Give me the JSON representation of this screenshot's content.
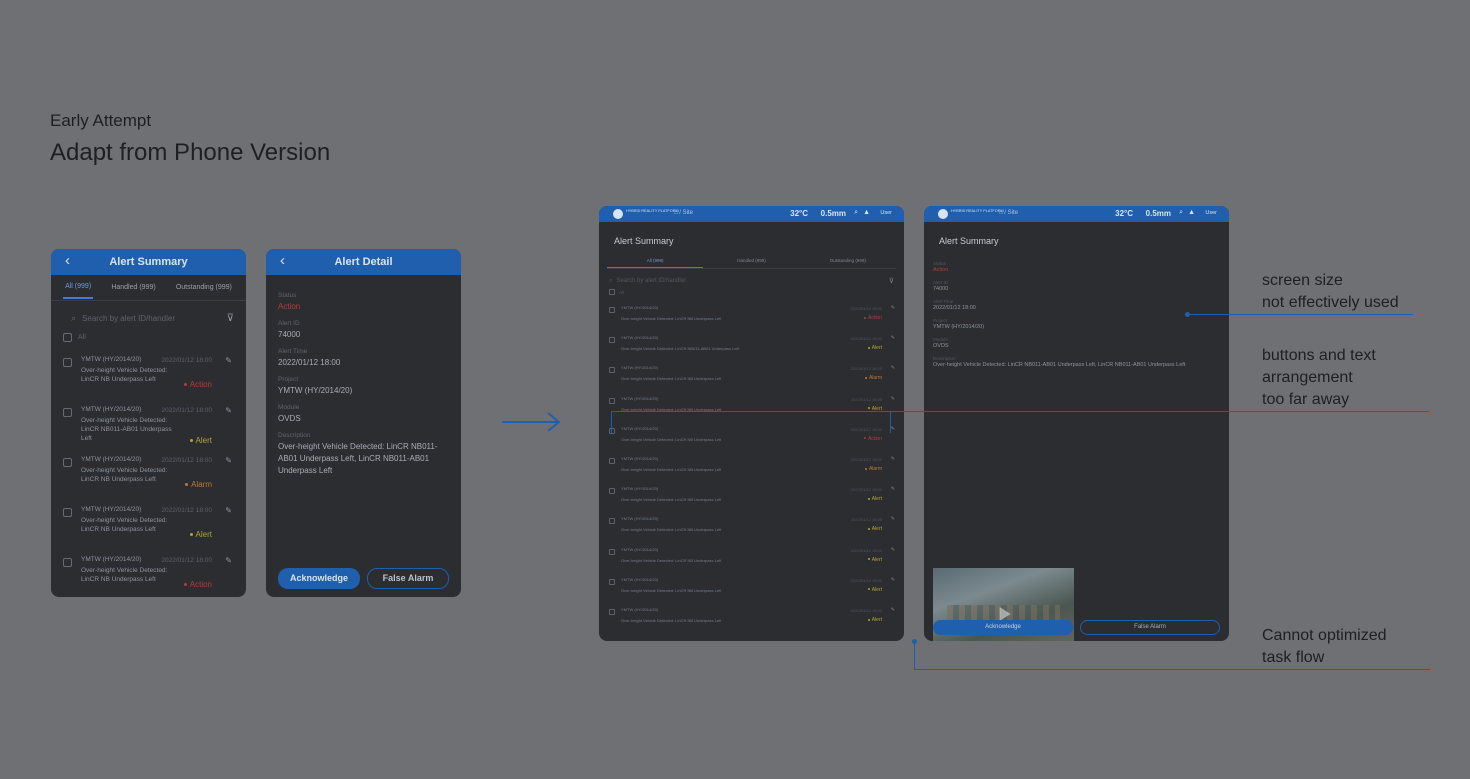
{
  "heading": {
    "sub": "Early Attempt",
    "main": "Adapt from Phone Version"
  },
  "colors": {
    "action": "#b83a3a",
    "alert": "#b5a233",
    "alarm": "#c07832",
    "accent": "#1f5fae"
  },
  "arrow_icon": "arrow-right-icon",
  "phone_summary": {
    "back": "‹",
    "title": "Alert Summary",
    "tabs": [
      "All (999)",
      "Handled (999)",
      "Outstanding (999)"
    ],
    "search_placeholder": "Search by alert ID/handler",
    "all_label": "All",
    "rows": [
      {
        "project": "YMTW (HY/2014/20)",
        "time": "2022/01/12 18:00",
        "desc": "Over-height Vehicle Detected: LinCR NB Underpass Left",
        "status": "Action"
      },
      {
        "project": "YMTW (HY/2014/20)",
        "time": "2022/01/12 18:00",
        "desc": "Over-height Vehicle Detected: LinCR NB011-AB01 Underpass Left",
        "status": "Alert"
      },
      {
        "project": "YMTW (HY/2014/20)",
        "time": "2022/01/12 18:00",
        "desc": "Over-height Vehicle Detected: LinCR NB Underpass Left",
        "status": "Alarm"
      },
      {
        "project": "YMTW (HY/2014/20)",
        "time": "2022/01/12 18:00",
        "desc": "Over-height Vehicle Detected: LinCR NB Underpass Left",
        "status": "Alert"
      },
      {
        "project": "YMTW (HY/2014/20)",
        "time": "2022/01/12 18:00",
        "desc": "Over-height Vehicle Detected: LinCR NB Underpass Left",
        "status": "Action"
      }
    ]
  },
  "phone_detail": {
    "back": "‹",
    "title": "Alert Detail",
    "fields": [
      {
        "label": "Status",
        "value": "Action"
      },
      {
        "label": "Alert ID",
        "value": "74000"
      },
      {
        "label": "Alert Time",
        "value": "2022/01/12 18:00"
      },
      {
        "label": "Project",
        "value": "YMTW (HY/2014/20)"
      },
      {
        "label": "Module",
        "value": "OVDS"
      },
      {
        "label": "Description",
        "value": "Over-height Vehicle Detected: LinCR NB011-AB01 Underpass Left, LinCR NB011-AB01 Underpass Left"
      }
    ],
    "acknowledge": "Acknowledge",
    "false_alarm": "False Alarm"
  },
  "tablet_top": {
    "brand": "HYBRID REALITY PLATFORM",
    "crumb": "⌂ / Site",
    "temp": "32°C",
    "rain": "0.5mm",
    "user": "User"
  },
  "tablet_summary": {
    "title": "Alert Summary",
    "tabs": [
      "All (999)",
      "Handled (999)",
      "Outstanding (999)"
    ],
    "search_placeholder": "Search by alert ID/handler",
    "all_label": "All",
    "rows": [
      {
        "project": "YMTW (HY/2014/20)",
        "time": "2022/01/12 18:00",
        "desc": "Over-height Vehicle Detected: LinCR NB Underpass Left",
        "status": "Action"
      },
      {
        "project": "YMTW (HY/2014/20)",
        "time": "2022/01/12 18:00",
        "desc": "Over-height Vehicle Detected: LinCR NB011-AB01 Underpass Left",
        "status": "Alert"
      },
      {
        "project": "YMTW (HY/2014/20)",
        "time": "2022/01/12 18:00",
        "desc": "Over-height Vehicle Detected: LinCR NB Underpass Left",
        "status": "Alarm"
      },
      {
        "project": "YMTW (HY/2014/20)",
        "time": "2022/01/12 18:00",
        "desc": "Over-height Vehicle Detected: LinCR NB Underpass Left",
        "status": "Alert"
      },
      {
        "project": "YMTW (HY/2014/20)",
        "time": "2022/01/12 18:00",
        "desc": "Over-height Vehicle Detected: LinCR NB Underpass Left",
        "status": "Action"
      },
      {
        "project": "YMTW (HY/2014/20)",
        "time": "2022/01/12 18:00",
        "desc": "Over-height Vehicle Detected: LinCR NB Underpass Left",
        "status": "Alarm"
      },
      {
        "project": "YMTW (HY/2014/20)",
        "time": "2022/01/12 18:00",
        "desc": "Over-height Vehicle Detected: LinCR NB Underpass Left",
        "status": "Alert"
      },
      {
        "project": "YMTW (HY/2014/20)",
        "time": "2022/01/12 18:00",
        "desc": "Over-height Vehicle Detected: LinCR NB Underpass Left",
        "status": "Alert"
      },
      {
        "project": "YMTW (HY/2014/20)",
        "time": "2022/01/12 18:00",
        "desc": "Over-height Vehicle Detected: LinCR NB Underpass Left",
        "status": "Alert"
      },
      {
        "project": "YMTW (HY/2014/20)",
        "time": "2022/01/12 18:00",
        "desc": "Over-height Vehicle Detected: LinCR NB Underpass Left",
        "status": "Alert"
      },
      {
        "project": "YMTW (HY/2014/20)",
        "time": "2022/01/12 18:00",
        "desc": "Over-height Vehicle Detected: LinCR NB Underpass Left",
        "status": "Alert"
      }
    ]
  },
  "tablet_detail": {
    "title": "Alert Summary",
    "fields": [
      {
        "label": "Status",
        "value": "Action"
      },
      {
        "label": "Alert ID",
        "value": "74000"
      },
      {
        "label": "Alert Time",
        "value": "2022/01/12 18:00"
      },
      {
        "label": "Project",
        "value": "YMTW (HY/2014/20)"
      },
      {
        "label": "Module",
        "value": "OVDS"
      },
      {
        "label": "Description",
        "value": "Over-height Vehicle Detected: LinCR NB011-AB01 Underpass Left, LinCR NB011-AB01 Underpass Left"
      }
    ],
    "acknowledge": "Acknowledge",
    "false_alarm": "False Alarm"
  },
  "annotations": {
    "screen_size": [
      "screen size",
      "not effectively used"
    ],
    "buttons": [
      "buttons and text",
      "arrangement",
      "too far away"
    ],
    "task_flow": [
      "Cannot optimized",
      "task flow"
    ]
  }
}
